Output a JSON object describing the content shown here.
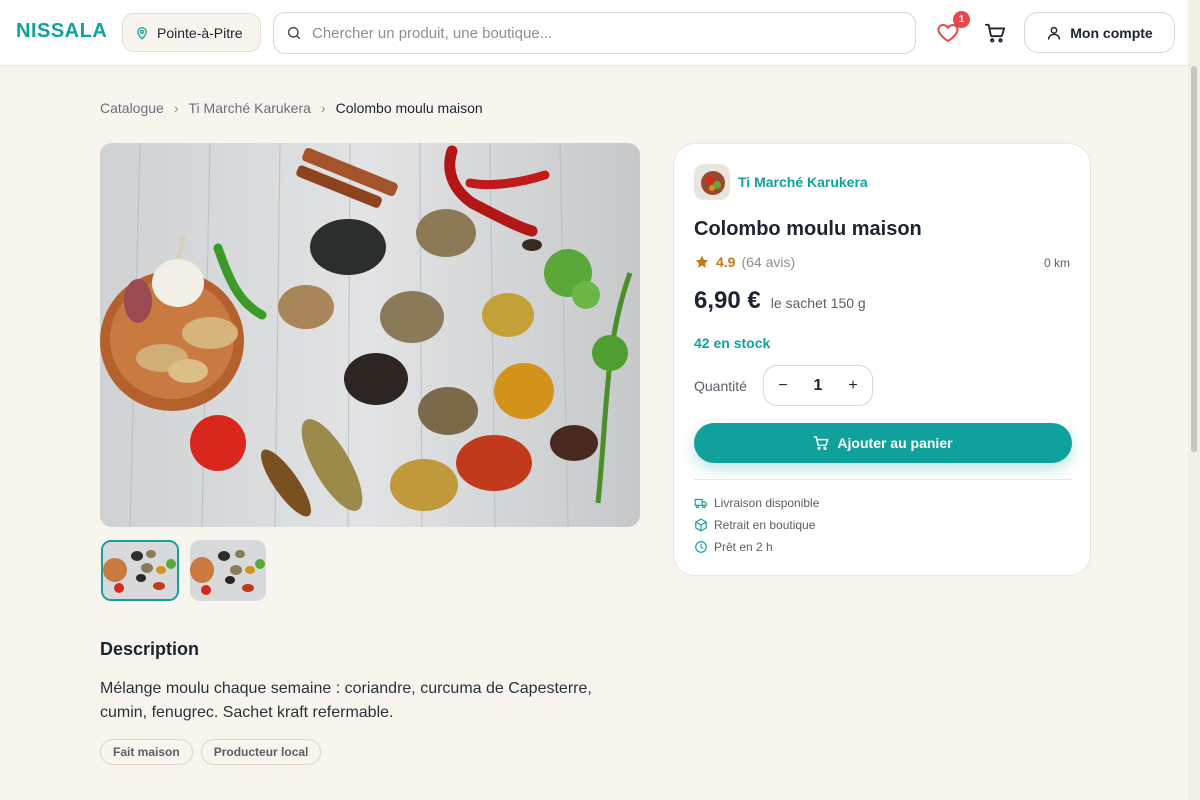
{
  "header": {
    "brand": "NISSALA",
    "location": "Pointe-à-Pitre",
    "search_placeholder": "Chercher un produit, une boutique...",
    "wishlist_count": "1",
    "account_label": "Mon compte"
  },
  "breadcrumb": [
    "Catalogue",
    "Ti Marché Karukera",
    "Colombo moulu maison"
  ],
  "product": {
    "shop_name": "Ti Marché Karukera",
    "title": "Colombo moulu maison",
    "rating": "4.9",
    "reviews": "(64 avis)",
    "distance": "0 km",
    "price": "6,90 €",
    "unit": "le sachet 150 g",
    "stock": "42 en stock",
    "quantity_label": "Quantité",
    "quantity": "1",
    "minus": "−",
    "plus": "+",
    "add_to_cart": "Ajouter au panier",
    "features": [
      "Livraison disponible",
      "Retrait en boutique",
      "Prêt en 2 h"
    ]
  },
  "description": {
    "title": "Description",
    "text": "Mélange moulu chaque semaine : coriandre, curcuma de Capesterre, cumin, fenugrec. Sachet kraft refermable.",
    "tags": [
      "Fait maison",
      "Producteur local"
    ]
  },
  "colors": {
    "accent": "#11a19c",
    "background": "#f8f4ee",
    "badge": "#e8464e",
    "rating": "#c27a12"
  }
}
